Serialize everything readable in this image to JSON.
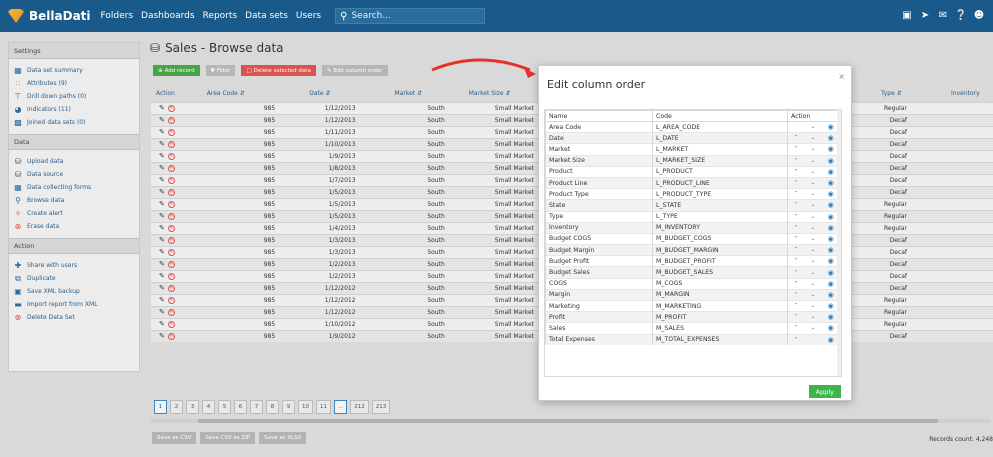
{
  "topbar": {
    "brand": "BellaDati",
    "nav": [
      "Folders",
      "Dashboards",
      "Reports",
      "Data sets",
      "Users"
    ],
    "search_placeholder": "Search...",
    "icons": [
      "image-icon",
      "rocket-icon",
      "mail-icon",
      "help-icon",
      "user-avatar-icon"
    ]
  },
  "sidebar": {
    "settings": {
      "title": "Settings",
      "items": [
        {
          "label": "Data set summary",
          "icon": "grid-icon"
        },
        {
          "label": "Attributes (9)",
          "icon": "attributes-icon"
        },
        {
          "label": "Drill down paths (0)",
          "icon": "hierarchy-icon"
        },
        {
          "label": "Indicators (11)",
          "icon": "gauge-icon"
        },
        {
          "label": "Joined data sets (0)",
          "icon": "join-icon"
        }
      ]
    },
    "data": {
      "title": "Data",
      "items": [
        {
          "label": "Upload data",
          "icon": "upload-icon"
        },
        {
          "label": "Data source",
          "icon": "database-icon"
        },
        {
          "label": "Data collecting forms",
          "icon": "table-icon"
        },
        {
          "label": "Browse data",
          "icon": "search-icon"
        },
        {
          "label": "Create alert",
          "icon": "alert-icon"
        },
        {
          "label": "Erase data",
          "icon": "erase-icon"
        }
      ]
    },
    "action": {
      "title": "Action",
      "items": [
        {
          "label": "Share with users",
          "icon": "share-icon"
        },
        {
          "label": "Duplicate",
          "icon": "duplicate-icon"
        },
        {
          "label": "Save XML backup",
          "icon": "save-icon"
        },
        {
          "label": "Import report from XML",
          "icon": "folder-icon"
        },
        {
          "label": "Delete Data Set",
          "icon": "delete-icon"
        }
      ]
    }
  },
  "page": {
    "title": "Sales - Browse data",
    "toolbar": {
      "add": "Add record",
      "filter": "Filter",
      "delete": "Delete selected data",
      "edit_columns": "Edit column order"
    },
    "columns": {
      "action": "Action",
      "area_code": "Area Code",
      "date": "Date",
      "market": "Market",
      "market_size": "Market Size",
      "type": "Type",
      "inventory": "Inventory"
    },
    "rows": [
      {
        "area": "985",
        "date": "1/12/2013",
        "market": "South",
        "size": "Small Market",
        "type": "Regular"
      },
      {
        "area": "985",
        "date": "1/12/2013",
        "market": "South",
        "size": "Small Market",
        "type": "Decaf"
      },
      {
        "area": "985",
        "date": "1/11/2013",
        "market": "South",
        "size": "Small Market",
        "type": "Decaf"
      },
      {
        "area": "985",
        "date": "1/10/2013",
        "market": "South",
        "size": "Small Market",
        "type": "Decaf"
      },
      {
        "area": "985",
        "date": "1/9/2013",
        "market": "South",
        "size": "Small Market",
        "type": "Decaf"
      },
      {
        "area": "985",
        "date": "1/8/2013",
        "market": "South",
        "size": "Small Market",
        "type": "Decaf"
      },
      {
        "area": "985",
        "date": "1/7/2013",
        "market": "South",
        "size": "Small Market",
        "type": "Decaf"
      },
      {
        "area": "985",
        "date": "1/5/2013",
        "market": "South",
        "size": "Small Market",
        "type": "Decaf"
      },
      {
        "area": "985",
        "date": "1/5/2013",
        "market": "South",
        "size": "Small Market",
        "type": "Regular"
      },
      {
        "area": "985",
        "date": "1/5/2013",
        "market": "South",
        "size": "Small Market",
        "type": "Regular"
      },
      {
        "area": "985",
        "date": "1/4/2013",
        "market": "South",
        "size": "Small Market",
        "type": "Regular"
      },
      {
        "area": "985",
        "date": "1/3/2013",
        "market": "South",
        "size": "Small Market",
        "type": "Decaf"
      },
      {
        "area": "985",
        "date": "1/3/2013",
        "market": "South",
        "size": "Small Market",
        "type": "Decaf"
      },
      {
        "area": "985",
        "date": "1/2/2013",
        "market": "South",
        "size": "Small Market",
        "type": "Decaf"
      },
      {
        "area": "985",
        "date": "1/2/2013",
        "market": "South",
        "size": "Small Market",
        "type": "Decaf"
      },
      {
        "area": "985",
        "date": "1/12/2012",
        "market": "South",
        "size": "Small Market",
        "type": "Decaf"
      },
      {
        "area": "985",
        "date": "1/12/2012",
        "market": "South",
        "size": "Small Market",
        "type": "Regular"
      },
      {
        "area": "985",
        "date": "1/12/2012",
        "market": "South",
        "size": "Small Market",
        "type": "Regular"
      },
      {
        "area": "985",
        "date": "1/10/2012",
        "market": "South",
        "size": "Small Market",
        "type": "Regular"
      },
      {
        "area": "985",
        "date": "1/9/2012",
        "market": "South",
        "size": "Small Market",
        "type": "Decaf"
      }
    ],
    "pagination": [
      "1",
      "2",
      "3",
      "4",
      "5",
      "6",
      "7",
      "8",
      "9",
      "10",
      "11",
      "...",
      "212",
      "213"
    ],
    "active_page": "1",
    "exports": [
      "Save as CSV",
      "Save CSV as ZIP",
      "Save as XLSX"
    ],
    "record_count": "Records count: 4,248"
  },
  "modal": {
    "title": "Edit column order",
    "close": "×",
    "headers": {
      "name": "Name",
      "code": "Code",
      "action": "Action"
    },
    "rows": [
      {
        "name": "Area Code",
        "code": "L_AREA_CODE"
      },
      {
        "name": "Date",
        "code": "L_DATE"
      },
      {
        "name": "Market",
        "code": "L_MARKET"
      },
      {
        "name": "Market Size",
        "code": "L_MARKET_SIZE"
      },
      {
        "name": "Product",
        "code": "L_PRODUCT"
      },
      {
        "name": "Product Line",
        "code": "L_PRODUCT_LINE"
      },
      {
        "name": "Product Type",
        "code": "L_PRODUCT_TYPE"
      },
      {
        "name": "State",
        "code": "L_STATE"
      },
      {
        "name": "Type",
        "code": "L_TYPE"
      },
      {
        "name": "Inventory",
        "code": "M_INVENTORY"
      },
      {
        "name": "Budget COGS",
        "code": "M_BUDGET_COGS"
      },
      {
        "name": "Budget Margin",
        "code": "M_BUDGET_MARGIN"
      },
      {
        "name": "Budget Profit",
        "code": "M_BUDGET_PROFIT"
      },
      {
        "name": "Budget Sales",
        "code": "M_BUDGET_SALES"
      },
      {
        "name": "COGS",
        "code": "M_COGS"
      },
      {
        "name": "Margin",
        "code": "M_MARGIN"
      },
      {
        "name": "Marketing",
        "code": "M_MARKETING"
      },
      {
        "name": "Profit",
        "code": "M_PROFIT"
      },
      {
        "name": "Sales",
        "code": "M_SALES"
      },
      {
        "name": "Total Expenses",
        "code": "M_TOTAL_EXPENSES"
      }
    ],
    "apply": "Apply"
  },
  "colors": {
    "topbar": "#1a5a8a",
    "accent_red": "#d9534f",
    "apply_green": "#3cb54a",
    "arrow_red": "#e5332a"
  }
}
